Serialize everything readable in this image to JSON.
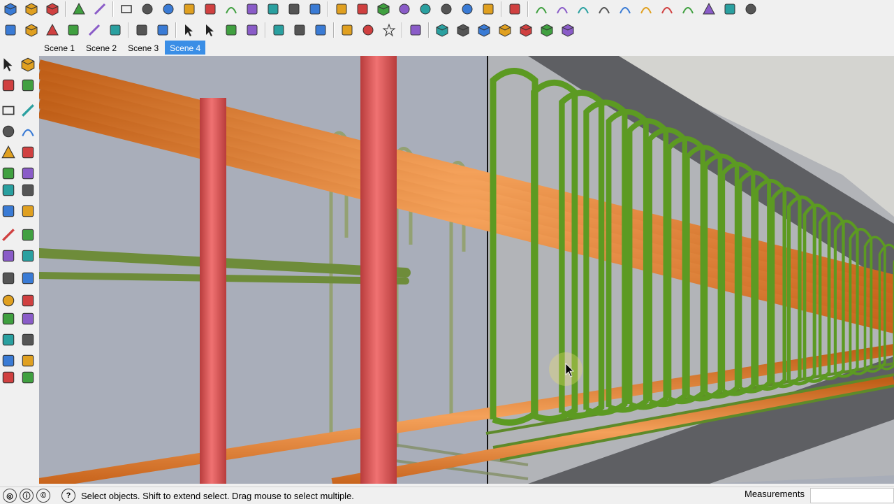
{
  "scenes": {
    "tabs": [
      "Scene 1",
      "Scene 2",
      "Scene 3",
      "Scene 4"
    ],
    "active_index": 3
  },
  "status": {
    "hint": "Select objects. Shift to extend select. Drag mouse to select multiple."
  },
  "measurements": {
    "label": "Measurements",
    "value": ""
  },
  "colors": {
    "rebar_longitudinal": "#f08a2c",
    "rebar_stirrup": "#6e9a2f",
    "rebar_vertical": "#e05a5a",
    "background_face": "#a8adb8",
    "active_tab": "#3a8ee6"
  },
  "toolbar_top_icons": [
    "cube-icon",
    "box-icon",
    "box-icon",
    "polygon-icon",
    "pencil-icon",
    "rectangle-icon",
    "circle-icon",
    "circle-icon",
    "ellipse-icon",
    "parallelogram-icon",
    "arc-icon",
    "freehand-icon",
    "lasso-icon",
    "lasso-icon",
    "move-icon",
    "eraser-icon",
    "shape-icon",
    "sandbox-icon",
    "sphere-icon",
    "sphere-icon",
    "sphere-icon",
    "sphere-icon",
    "hand-icon",
    "lock-icon",
    "curve-icon",
    "curve-icon",
    "curve-icon",
    "spiral-icon",
    "curve-icon",
    "curve-icon",
    "curve-icon",
    "curve-icon",
    "polygon-icon",
    "wrench-icon",
    "circle-icon"
  ],
  "toolbar_second_icons": [
    "iso-view-icon",
    "wire-cube-icon",
    "triangle-icon",
    "axes-icon",
    "tape-icon",
    "layer-icon",
    "paint-icon",
    "section-icon",
    "arrows-up-icon",
    "arrows-down-icon",
    "scale-icon",
    "push-icon",
    "rotate-icon",
    "undo-icon",
    "follow-icon",
    "section-plane-icon",
    "sphere-icon",
    "star-icon",
    "mirror-icon",
    "cube-view-icon",
    "cube-view-icon",
    "cube-view-icon",
    "cube-view-icon",
    "cube-view-icon",
    "stack-icon",
    "cube-view-icon"
  ],
  "left_toolbar_icons": [
    "select-arrow-icon",
    "component-icon",
    "paint-bucket-icon",
    "eraser-icon",
    "rectangle-icon",
    "pencil-icon",
    "circle-icon",
    "arc-icon",
    "polygon-icon",
    "freehand-icon",
    "move-icon",
    "push-pull-icon",
    "rotate-icon",
    "follow-me-icon",
    "scale-icon",
    "offset-icon",
    "tape-measure-icon",
    "dimension-icon",
    "protractor-icon",
    "text-icon",
    "axes-icon",
    "3d-text-icon",
    "orbit-icon",
    "pan-icon",
    "zoom-icon",
    "zoom-extents-icon",
    "previous-view-icon",
    "next-view-icon",
    "position-camera-icon",
    "look-around-icon",
    "walk-icon",
    "section-plane-icon"
  ]
}
